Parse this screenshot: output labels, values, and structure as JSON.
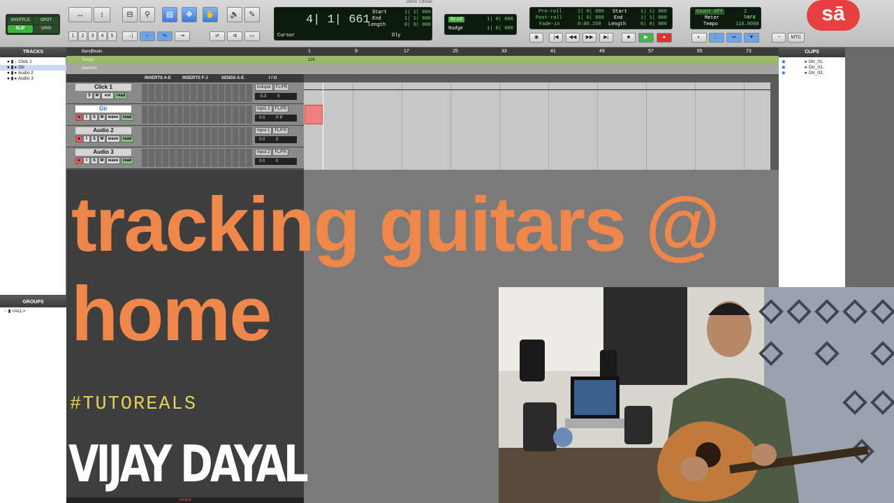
{
  "window_title": "Demo Tutorial",
  "modes": {
    "shuffle": "SHUFFLE",
    "spot": "SPOT",
    "slip": "SLIP",
    "grid": "GRID"
  },
  "zoom_presets": [
    "1",
    "2",
    "3",
    "4",
    "5"
  ],
  "counter": {
    "main": "4| 1| 661",
    "start_label": "Start",
    "end_label": "End",
    "length_label": "Length",
    "start": "1| 1| 000",
    "end": "1| 1| 000",
    "length": "0| 0| 000",
    "cursor_label": "Cursor",
    "dly_label": "Dly"
  },
  "grid": {
    "grid_label": "Grid",
    "grid_value": "1| 0| 000",
    "nudge_label": "Nudge",
    "nudge_value": "1| 0| 000"
  },
  "prepost": {
    "preroll_label": "Pre-roll",
    "preroll": "2| 0| 000",
    "postroll_label": "Post-roll",
    "postroll": "1| 0| 000",
    "fadein_label": "Fade-in",
    "fadein": "0:00.250",
    "start_label": "Start",
    "start": "1| 1| 000",
    "end_label": "End",
    "end": "1| 1| 000",
    "length_label": "Length",
    "length": "0| 0| 000"
  },
  "meter": {
    "countoff_label": "Count Off",
    "countoff": "2 bars",
    "meter_label": "Meter",
    "meter": "4/4",
    "tempo_label": "Tempo",
    "tempo": "116.0000"
  },
  "mtc_label": "MTC",
  "tracks_panel": {
    "title": "TRACKS",
    "items": [
      "Click 1",
      "Gtr",
      "Audio 2",
      "Audio 3"
    ]
  },
  "groups_panel": {
    "title": "GROUPS",
    "items": [
      "<ALL>"
    ]
  },
  "clips_panel": {
    "title": "CLIPS",
    "items": [
      "Gtr_01.",
      "Gtr_01.",
      "Gtr_02."
    ]
  },
  "rulers": {
    "barsbeats": "Bars|Beats",
    "tempo": "Tempo",
    "markers": "Markers",
    "tempo_marker": "116",
    "bars": [
      "1",
      "9",
      "17",
      "25",
      "33",
      "41",
      "49",
      "57",
      "65",
      "73"
    ]
  },
  "mix_header": {
    "inserts_ae": "INSERTS A-E",
    "inserts_fj": "INSERTS F-J",
    "sends_ae": "SENDS A-E",
    "io": "I / O"
  },
  "tracks": [
    {
      "name": "Click 1",
      "btns": [
        "S",
        "M",
        "vol",
        "read"
      ],
      "input": "noinput",
      "output": "FL/FR",
      "value": "-5.3",
      "pan": "0"
    },
    {
      "name": "Gtr",
      "btns": [
        "I",
        "S",
        "M",
        "wave",
        "read"
      ],
      "input": "Inpt1-2",
      "output": "FL/FR",
      "value": "0.0",
      "pan": "P  P"
    },
    {
      "name": "Audio 2",
      "btns": [
        "I",
        "S",
        "M",
        "wave",
        "read"
      ],
      "input": "Input 1",
      "output": "FL/FR",
      "value": "0.0",
      "pan": "0"
    },
    {
      "name": "Audio 3",
      "btns": [
        "I",
        "S",
        "M",
        "wave",
        "read"
      ],
      "input": "Input 2",
      "output": "FL/FR",
      "value": "0.0",
      "pan": "0"
    }
  ],
  "overlay": {
    "headline_line1": "tracking guitars @",
    "headline_line2": "home",
    "hashtag": "#TUTOREALS",
    "author": "VIJAY DAYAL"
  },
  "logo_text": "sā",
  "bottom_status": "record",
  "colors": {
    "headline": "#f0874a",
    "hashtag": "#e2d25a",
    "logo": "#e74040"
  }
}
